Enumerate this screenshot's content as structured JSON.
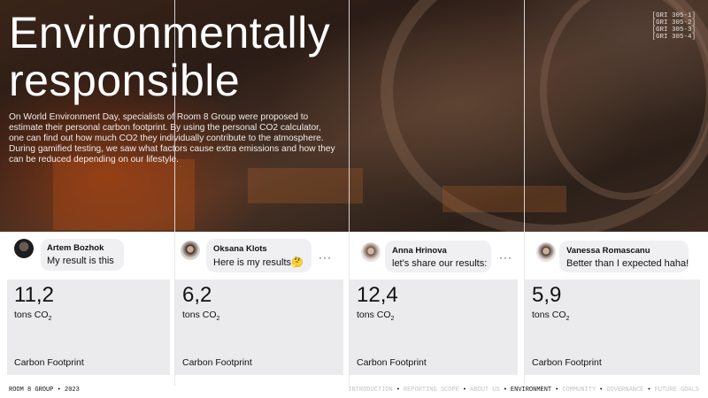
{
  "header": {
    "title_line1": "Environmentally",
    "title_line2": "responsible",
    "intro": "On World Environment Day, specialists of Room 8 Group were proposed to estimate their personal carbon footprint. By using the personal CO2 calculator, one can find out how much CO2 they individually contribute to the atmosphere. During gamified testing, we saw what factors cause extra emissions and how they can be reduced depending on our lifestyle.",
    "gri": [
      "[GRI 305-1]",
      "[GRI 305-2]",
      "[GRI 305-3]",
      "[GRI 305-4]"
    ]
  },
  "posts": [
    {
      "name": "Artem Bozhok",
      "message": "My result is this",
      "value": "11,2",
      "unit": "tons CO",
      "unit_sub": "2",
      "label": "Carbon Footprint"
    },
    {
      "name": "Oksana Klots",
      "message": "Here is my results🤔",
      "value": "6,2",
      "unit": "tons CO",
      "unit_sub": "2",
      "label": "Carbon Footprint",
      "more": "···"
    },
    {
      "name": "Anna Hrinova",
      "message": "let's share our results:",
      "value": "12,4",
      "unit": "tons CO",
      "unit_sub": "2",
      "label": "Carbon Footprint",
      "more": "···"
    },
    {
      "name": "Vanessa Romascanu",
      "message": "Better than I expected haha!",
      "value": "5,9",
      "unit": "tons CO",
      "unit_sub": "2",
      "label": "Carbon Footprint"
    }
  ],
  "footer": {
    "left": "ROOM 8 GROUP • 2023",
    "nav": [
      "INTRODUCTION",
      "REPORTING SCOPE",
      "ABOUT US",
      "ENVIRONMENT",
      "COMMUNITY",
      "GOVERNANCE",
      "FUTURE GOALS"
    ],
    "separator": "•",
    "active": "ENVIRONMENT"
  }
}
